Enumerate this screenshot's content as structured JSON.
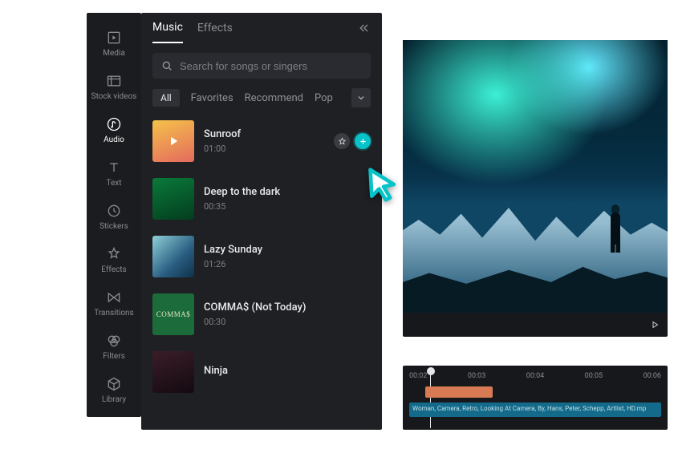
{
  "sidebar": {
    "items": [
      {
        "label": "Media"
      },
      {
        "label": "Stock videos"
      },
      {
        "label": "Audio"
      },
      {
        "label": "Text"
      },
      {
        "label": "Stickers"
      },
      {
        "label": "Effects"
      },
      {
        "label": "Transitions"
      },
      {
        "label": "Filters"
      },
      {
        "label": "Library"
      }
    ]
  },
  "panel": {
    "tabs": {
      "music": "Music",
      "effects": "Effects"
    },
    "search": {
      "placeholder": "Search for songs or singers"
    },
    "filters": {
      "all": "All",
      "favorites": "Favorites",
      "recommend": "Recommend",
      "pop": "Pop"
    }
  },
  "tracks": [
    {
      "name": "Sunroof",
      "duration": "01:00"
    },
    {
      "name": "Deep to the dark",
      "duration": "00:35"
    },
    {
      "name": "Lazy Sunday",
      "duration": "01:26"
    },
    {
      "name": "COMMA$ (Not Today)",
      "duration": "00:30"
    },
    {
      "name": "Ninja",
      "duration": ""
    }
  ],
  "timeline": {
    "ticks": [
      "00:02",
      "00:03",
      "00:04",
      "00:05",
      "00:06"
    ],
    "clip_label": "Woman, Camera, Retro, Looking At Camera, By, Hans, Peter, Schepp, Artlist, HD.mp"
  },
  "colors": {
    "accent": "#05c3c8",
    "panel": "#1f2024",
    "bg": "#17181b"
  }
}
